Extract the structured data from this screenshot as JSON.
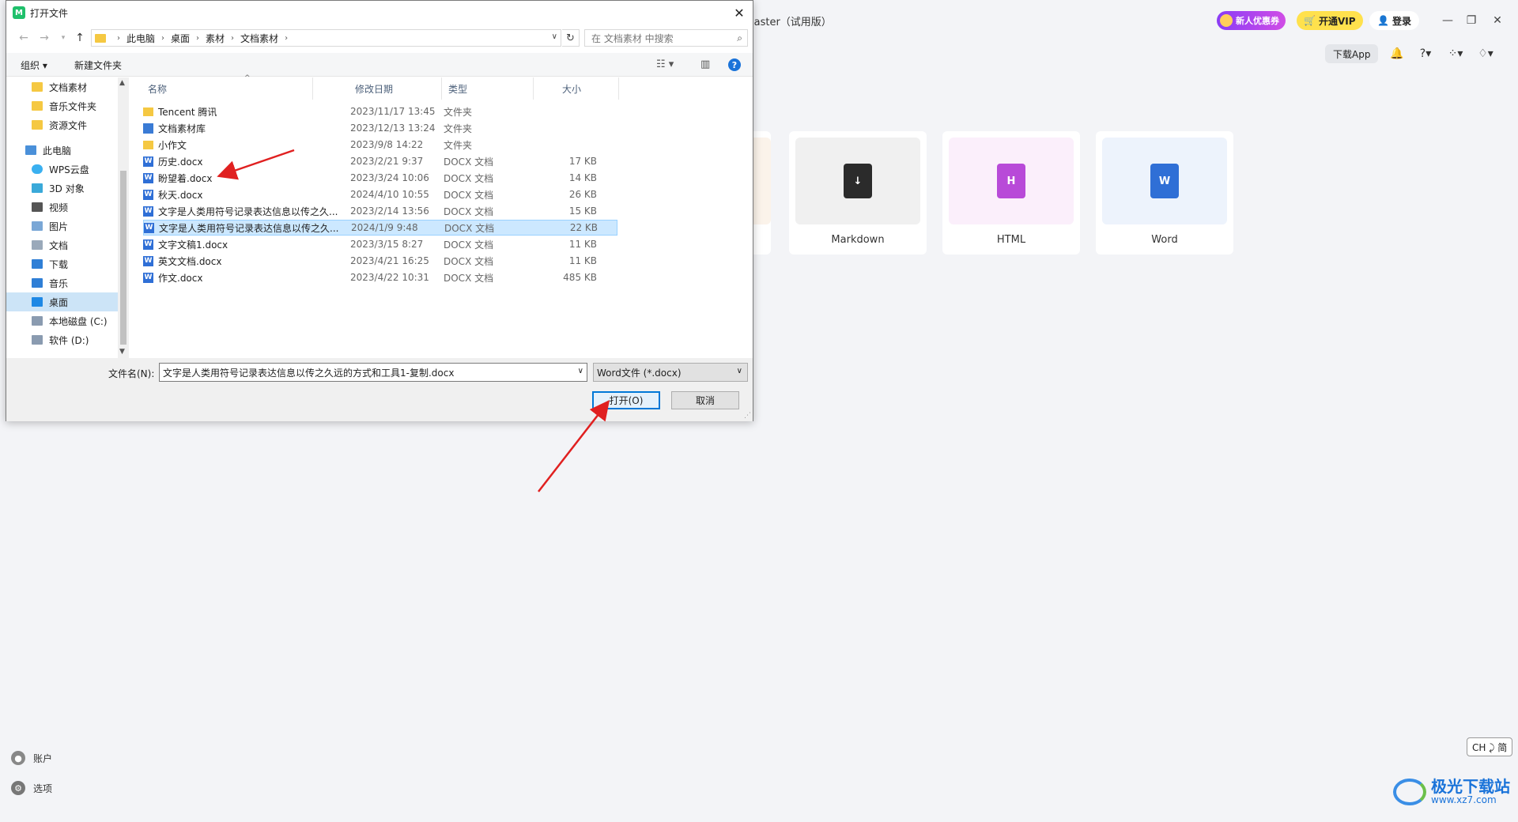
{
  "app": {
    "title": "laster（试用版）",
    "promo_label": "新人优惠券",
    "vip_label": "开通VIP",
    "login_label": "登录",
    "download_app_label": "下载App",
    "cards": [
      {
        "label": "Markdown",
        "icon": "markdown-file-icon",
        "color": "#2b2b2b"
      },
      {
        "label": "HTML",
        "icon": "html-file-icon",
        "color": "#b84ad8"
      },
      {
        "label": "Word",
        "icon": "word-file-icon",
        "color": "#2f6fd6"
      }
    ],
    "sidebar_bottom": {
      "account_label": "账户",
      "options_label": "选项"
    },
    "ime_indicator": "CH ⤸ 简",
    "watermark": {
      "text": "极光下载站",
      "url": "www.xz7.com"
    }
  },
  "dialog": {
    "title": "打开文件",
    "breadcrumb": [
      "此电脑",
      "桌面",
      "素材",
      "文档素材"
    ],
    "search_placeholder": "在 文档素材 中搜索",
    "toolbar": {
      "organize_label": "组织 ▾",
      "new_folder_label": "新建文件夹"
    },
    "tree": [
      {
        "label": "文档素材",
        "icon": "folder-icon"
      },
      {
        "label": "音乐文件夹",
        "icon": "folder-icon"
      },
      {
        "label": "资源文件",
        "icon": "folder-icon"
      },
      {
        "label": "此电脑",
        "icon": "computer-icon"
      },
      {
        "label": "WPS云盘",
        "icon": "cloud-icon"
      },
      {
        "label": "3D 对象",
        "icon": "cube-icon"
      },
      {
        "label": "视频",
        "icon": "video-icon"
      },
      {
        "label": "图片",
        "icon": "picture-icon"
      },
      {
        "label": "文档",
        "icon": "document-icon"
      },
      {
        "label": "下载",
        "icon": "download-icon"
      },
      {
        "label": "音乐",
        "icon": "music-icon"
      },
      {
        "label": "桌面",
        "icon": "desktop-icon",
        "selected": true
      },
      {
        "label": "本地磁盘 (C:)",
        "icon": "drive-icon"
      },
      {
        "label": "软件 (D:)",
        "icon": "drive-icon"
      }
    ],
    "columns": {
      "name": "名称",
      "date": "修改日期",
      "type": "类型",
      "size": "大小"
    },
    "files": [
      {
        "name": "Tencent 腾讯",
        "date": "2023/11/17 13:45",
        "type": "文件夹",
        "size": "",
        "kind": "folder"
      },
      {
        "name": "文档素材库",
        "date": "2023/12/13 13:24",
        "type": "文件夹",
        "size": "",
        "kind": "lib"
      },
      {
        "name": "小作文",
        "date": "2023/9/8 14:22",
        "type": "文件夹",
        "size": "",
        "kind": "folder"
      },
      {
        "name": "历史.docx",
        "date": "2023/2/21 9:37",
        "type": "DOCX 文档",
        "size": "17 KB",
        "kind": "doc"
      },
      {
        "name": "盼望着.docx",
        "date": "2023/3/24 10:06",
        "type": "DOCX 文档",
        "size": "14 KB",
        "kind": "doc"
      },
      {
        "name": "秋天.docx",
        "date": "2024/4/10 10:55",
        "type": "DOCX 文档",
        "size": "26 KB",
        "kind": "doc"
      },
      {
        "name": "文字是人类用符号记录表达信息以传之久...",
        "date": "2023/2/14 13:56",
        "type": "DOCX 文档",
        "size": "15 KB",
        "kind": "doc"
      },
      {
        "name": "文字是人类用符号记录表达信息以传之久...",
        "date": "2024/1/9 9:48",
        "type": "DOCX 文档",
        "size": "22 KB",
        "kind": "doc",
        "selected": true
      },
      {
        "name": "文字文稿1.docx",
        "date": "2023/3/15 8:27",
        "type": "DOCX 文档",
        "size": "11 KB",
        "kind": "doc"
      },
      {
        "name": "英文文档.docx",
        "date": "2023/4/21 16:25",
        "type": "DOCX 文档",
        "size": "11 KB",
        "kind": "doc"
      },
      {
        "name": "作文.docx",
        "date": "2023/4/22 10:31",
        "type": "DOCX 文档",
        "size": "485 KB",
        "kind": "doc"
      }
    ],
    "filename_label": "文件名(N):",
    "filename_value": "文字是人类用符号记录表达信息以传之久远的方式和工具1-复制.docx",
    "filetype_value": "Word文件 (*.docx)",
    "open_label": "打开(O)",
    "cancel_label": "取消"
  },
  "colors": {
    "accent": "#0078d7",
    "selection": "#cce8ff",
    "annotation_arrow": "#e02020"
  }
}
